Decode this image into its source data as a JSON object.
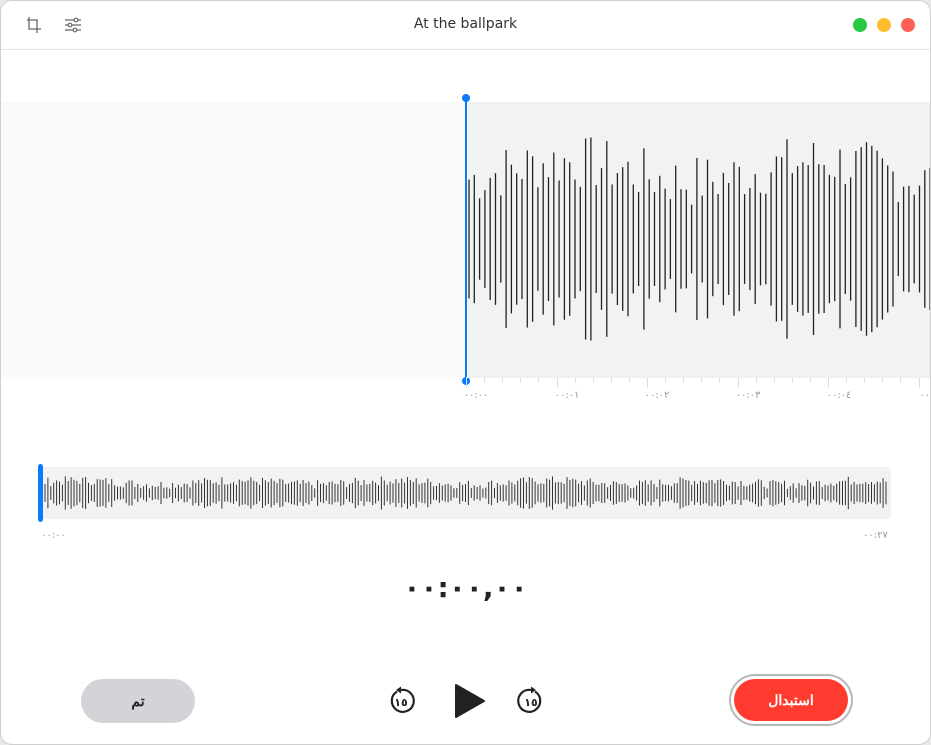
{
  "window": {
    "title": "At the ballpark",
    "traffic_lights": {
      "zoom": "#28c840",
      "minimize": "#febc2e",
      "close": "#ff5f57"
    }
  },
  "toolbar": {
    "icons": [
      "crop-icon",
      "sliders-icon"
    ]
  },
  "ruler": {
    "labels": [
      "٠٠:٠٠",
      "٠٠:٠١",
      "٠٠:٠٢",
      "٠٠:٠٣",
      "٠٠:٠٤",
      "٠٠:٠"
    ]
  },
  "overview": {
    "start_label": "٠٠:٠٠",
    "end_label": "٠٠:٢٧",
    "playhead_position": 0
  },
  "playback": {
    "time": "٠٠:٠٠,٠٠",
    "skip_back": "١٥",
    "skip_forward": "١٥"
  },
  "buttons": {
    "done": "تم",
    "replace": "استبدال"
  },
  "colors": {
    "accent": "#0a7aff",
    "replace": "#ff3b30"
  }
}
